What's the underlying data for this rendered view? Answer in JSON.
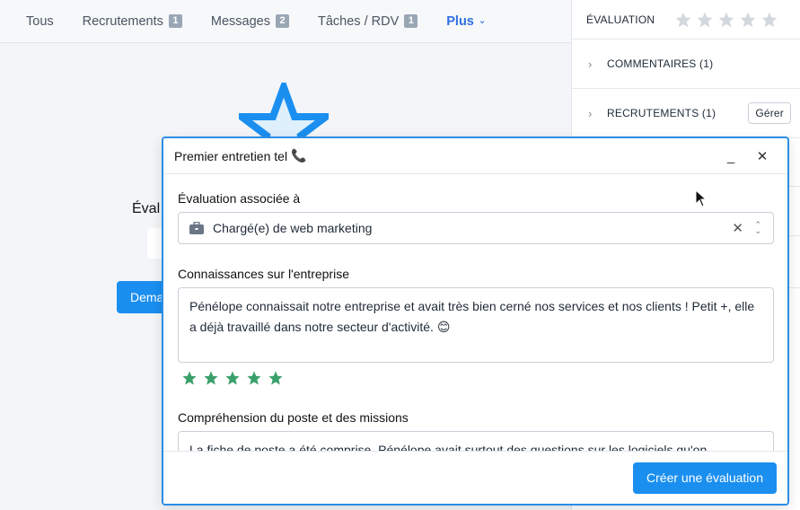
{
  "tabs": [
    {
      "label": "Tous",
      "count": null
    },
    {
      "label": "Recrutements",
      "count": "1"
    },
    {
      "label": "Messages",
      "count": "2"
    },
    {
      "label": "Tâches / RDV",
      "count": "1"
    }
  ],
  "more_tab": "Plus",
  "background": {
    "eval_label": "Éval",
    "button_label": "Dema"
  },
  "panel": {
    "evaluation_title": "ÉVALUATION",
    "evaluation_rating": 0,
    "comments": "COMMENTAIRES (1)",
    "recruitments": "RECRUTEMENTS (1)",
    "manage_button": "Gérer"
  },
  "modal": {
    "title": "Premier entretien tel",
    "title_emoji": "📞",
    "minimize": "_",
    "close": "✕",
    "assoc_label": "Évaluation associée à",
    "assoc_value": "Chargé(e) de web marketing",
    "section1_label": "Connaissances sur l'entreprise",
    "section1_text": "Pénélope connaissait notre entreprise et avait très bien cerné nos services et nos clients ! Petit +, elle a déjà travaillé dans notre secteur d'activité. 😊",
    "section1_rating": 5,
    "section2_label": "Compréhension du poste et des missions",
    "section2_text": "La fiche de poste a été comprise. Pénélope avait surtout des questions sur les logiciels qu'on",
    "create_button": "Créer une évaluation"
  },
  "colors": {
    "accent": "#1a8ff0",
    "modal_border": "#2b8de6",
    "green_star": "#3aa06a",
    "gray_star": "#d3d8de"
  }
}
